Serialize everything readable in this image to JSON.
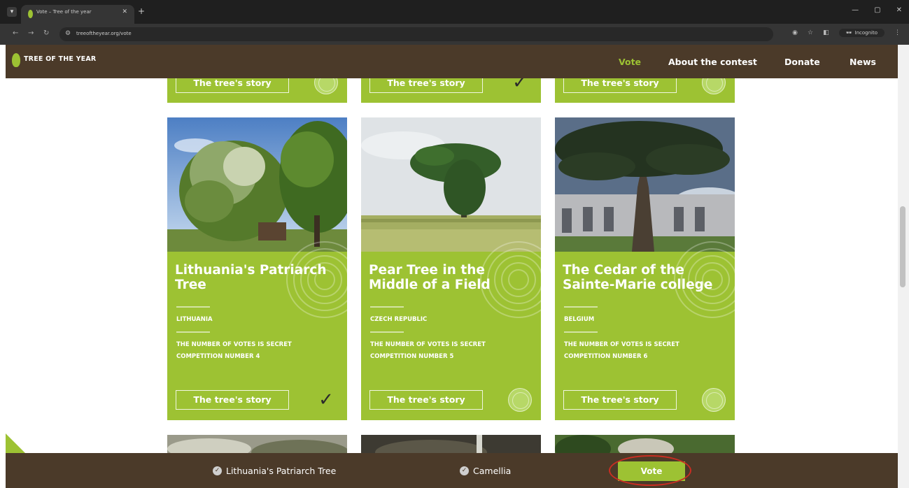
{
  "browser": {
    "tab_title": "Vote – Tree of the year",
    "url": "treeoftheyear.org/vote",
    "incognito_label": "Incognito",
    "menu_icon": "tab-search-icon"
  },
  "header": {
    "logo_text": "TREE OF THE YEAR",
    "nav": {
      "vote": "Vote",
      "about": "About the contest",
      "donate": "Donate",
      "news": "News"
    }
  },
  "top_row": [
    {
      "story_label": "The tree's story",
      "checked": false
    },
    {
      "story_label": "The tree's story",
      "checked": true
    },
    {
      "story_label": "The tree's story",
      "checked": false
    }
  ],
  "cards": [
    {
      "title": "Lithuania's Patriarch Tree",
      "country": "LITHUANIA",
      "votes": "THE NUMBER OF VOTES IS SECRET",
      "competition": "COMPETITION NUMBER 4",
      "story_label": "The tree's story",
      "checked": true
    },
    {
      "title": "Pear Tree in the Middle of a Field",
      "country": "CZECH REPUBLIC",
      "votes": "THE NUMBER OF VOTES IS SECRET",
      "competition": "COMPETITION NUMBER 5",
      "story_label": "The tree's story",
      "checked": false
    },
    {
      "title": "The Cedar of the Sainte-Marie college",
      "country": "BELGIUM",
      "votes": "THE NUMBER OF VOTES IS SECRET",
      "competition": "COMPETITION NUMBER 6",
      "story_label": "The tree's story",
      "checked": false
    }
  ],
  "bottom_bar": {
    "selected": [
      "Lithuania's Patriarch Tree",
      "Camellia"
    ],
    "vote_label": "Vote"
  },
  "colors": {
    "brown": "#4b3a29",
    "green": "#9dc233",
    "annotation": "#c92d22"
  }
}
